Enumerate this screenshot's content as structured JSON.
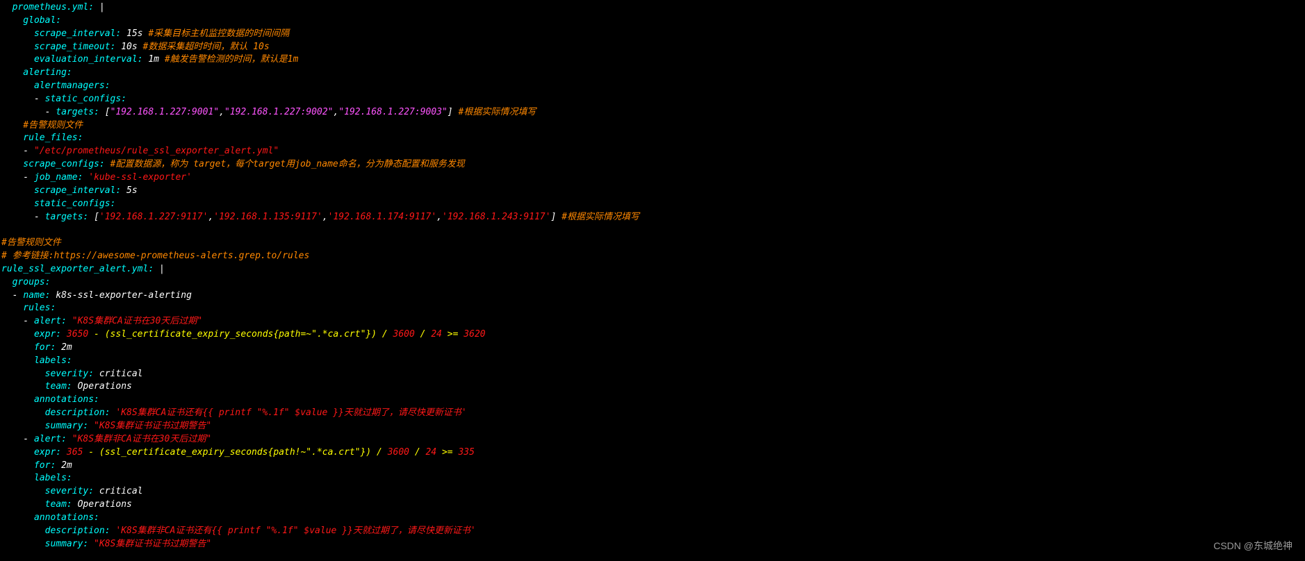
{
  "watermark": "CSDN @东城绝神",
  "blocks": [
    {
      "text": "  prometheus.yml:",
      "cls": "c-cyan"
    },
    {
      "text": " |",
      "cls": "c-white",
      "br": true
    },
    {
      "text": "    global:",
      "cls": "c-cyan",
      "br": true
    },
    {
      "text": "      scrape_interval:",
      "cls": "c-cyan"
    },
    {
      "text": " 15s ",
      "cls": "c-white"
    },
    {
      "text": "#采集目标主机监控数据的时间间隔",
      "cls": "c-orange",
      "br": true
    },
    {
      "text": "      scrape_timeout:",
      "cls": "c-cyan"
    },
    {
      "text": " 10s ",
      "cls": "c-white"
    },
    {
      "text": "#数据采集超时时间，默认 10s",
      "cls": "c-orange",
      "br": true
    },
    {
      "text": "      evaluation_interval:",
      "cls": "c-cyan"
    },
    {
      "text": " 1m ",
      "cls": "c-white"
    },
    {
      "text": "#触发告警检测的时间，默认是1m",
      "cls": "c-orange",
      "br": true
    },
    {
      "text": "    alerting:",
      "cls": "c-cyan",
      "br": true
    },
    {
      "text": "      alertmanagers:",
      "cls": "c-cyan",
      "br": true
    },
    {
      "text": "      - ",
      "cls": "c-white"
    },
    {
      "text": "static_configs:",
      "cls": "c-cyan",
      "br": true
    },
    {
      "text": "        - ",
      "cls": "c-white"
    },
    {
      "text": "targets:",
      "cls": "c-cyan"
    },
    {
      "text": " [",
      "cls": "c-white"
    },
    {
      "text": "\"192.168.1.227:9001\"",
      "cls": "c-magenta"
    },
    {
      "text": ",",
      "cls": "c-white"
    },
    {
      "text": "\"192.168.1.227:9002\"",
      "cls": "c-magenta"
    },
    {
      "text": ",",
      "cls": "c-white"
    },
    {
      "text": "\"192.168.1.227:9003\"",
      "cls": "c-magenta"
    },
    {
      "text": "] ",
      "cls": "c-white"
    },
    {
      "text": "#根据实际情况填写",
      "cls": "c-orange",
      "br": true
    },
    {
      "text": "    #告警规则文件",
      "cls": "c-orange",
      "br": true
    },
    {
      "text": "    rule_files:",
      "cls": "c-cyan",
      "br": true
    },
    {
      "text": "    - ",
      "cls": "c-white"
    },
    {
      "text": "\"/etc/prometheus/rule_ssl_exporter_alert.yml\"",
      "cls": "c-red",
      "br": true
    },
    {
      "text": "    scrape_configs:",
      "cls": "c-cyan"
    },
    {
      "text": " #配置数据源，称为 target，每个target用job_name命名，分为静态配置和服务发现",
      "cls": "c-orange",
      "br": true
    },
    {
      "text": "    - ",
      "cls": "c-white"
    },
    {
      "text": "job_name:",
      "cls": "c-cyan"
    },
    {
      "text": " 'kube-ssl-exporter'",
      "cls": "c-red",
      "br": true
    },
    {
      "text": "      scrape_interval:",
      "cls": "c-cyan"
    },
    {
      "text": " 5s",
      "cls": "c-white",
      "br": true
    },
    {
      "text": "      static_configs:",
      "cls": "c-cyan",
      "br": true
    },
    {
      "text": "      - ",
      "cls": "c-white"
    },
    {
      "text": "targets:",
      "cls": "c-cyan"
    },
    {
      "text": " [",
      "cls": "c-white"
    },
    {
      "text": "'192.168.1.227:9117'",
      "cls": "c-red"
    },
    {
      "text": ",",
      "cls": "c-white"
    },
    {
      "text": "'192.168.1.135:9117'",
      "cls": "c-red"
    },
    {
      "text": ",",
      "cls": "c-white"
    },
    {
      "text": "'192.168.1.174:9117'",
      "cls": "c-red"
    },
    {
      "text": ",",
      "cls": "c-white"
    },
    {
      "text": "'192.168.1.243:9117'",
      "cls": "c-red"
    },
    {
      "text": "] ",
      "cls": "c-white"
    },
    {
      "text": "#根据实际情况填写",
      "cls": "c-orange",
      "br": true
    },
    {
      "text": " ",
      "cls": "c-white",
      "br": true
    },
    {
      "text": "#告警规则文件",
      "cls": "c-orange",
      "br": true
    },
    {
      "text": "# 参考链接:https://awesome-prometheus-alerts.grep.to/rules",
      "cls": "c-orange",
      "br": true
    },
    {
      "text": "rule_ssl_exporter_alert.yml:",
      "cls": "c-cyan"
    },
    {
      "text": " |",
      "cls": "c-white",
      "br": true
    },
    {
      "text": "  groups:",
      "cls": "c-cyan",
      "br": true
    },
    {
      "text": "  - ",
      "cls": "c-white"
    },
    {
      "text": "name:",
      "cls": "c-cyan"
    },
    {
      "text": " k8s-ssl-exporter-alerting",
      "cls": "c-white",
      "br": true
    },
    {
      "text": "    rules:",
      "cls": "c-cyan",
      "br": true
    },
    {
      "text": "    - ",
      "cls": "c-white"
    },
    {
      "text": "alert:",
      "cls": "c-cyan"
    },
    {
      "text": " \"K8S集群CA证书在30天后过期\"",
      "cls": "c-red",
      "br": true
    },
    {
      "text": "      expr:",
      "cls": "c-cyan"
    },
    {
      "text": " 3650",
      "cls": "c-red"
    },
    {
      "text": " - (ssl_certificate_expiry_seconds{path=~\".*ca.crt\"}) / ",
      "cls": "c-yellow"
    },
    {
      "text": "3600",
      "cls": "c-red"
    },
    {
      "text": " / ",
      "cls": "c-yellow"
    },
    {
      "text": "24",
      "cls": "c-red"
    },
    {
      "text": " >= ",
      "cls": "c-yellow"
    },
    {
      "text": "3620",
      "cls": "c-red",
      "br": true
    },
    {
      "text": "      for:",
      "cls": "c-cyan"
    },
    {
      "text": " 2m",
      "cls": "c-white",
      "br": true
    },
    {
      "text": "      labels:",
      "cls": "c-cyan",
      "br": true
    },
    {
      "text": "        severity:",
      "cls": "c-cyan"
    },
    {
      "text": " critical",
      "cls": "c-white",
      "br": true
    },
    {
      "text": "        team:",
      "cls": "c-cyan"
    },
    {
      "text": " Operations",
      "cls": "c-white",
      "br": true
    },
    {
      "text": "      annotations:",
      "cls": "c-cyan",
      "br": true
    },
    {
      "text": "        description:",
      "cls": "c-cyan"
    },
    {
      "text": " 'K8S集群CA证书还有{{ printf \"%.1f\" $value }}天就过期了，请尽快更新证书'",
      "cls": "c-red",
      "br": true
    },
    {
      "text": "        summary:",
      "cls": "c-cyan"
    },
    {
      "text": " \"K8S集群证书证书过期警告\"",
      "cls": "c-red",
      "br": true
    },
    {
      "text": "    - ",
      "cls": "c-white"
    },
    {
      "text": "alert:",
      "cls": "c-cyan"
    },
    {
      "text": " \"K8S集群非CA证书在30天后过期\"",
      "cls": "c-red",
      "br": true
    },
    {
      "text": "      expr:",
      "cls": "c-cyan"
    },
    {
      "text": " 365",
      "cls": "c-red"
    },
    {
      "text": " - (ssl_certificate_expiry_seconds{path!~\".*ca.crt\"}) / ",
      "cls": "c-yellow"
    },
    {
      "text": "3600",
      "cls": "c-red"
    },
    {
      "text": " / ",
      "cls": "c-yellow"
    },
    {
      "text": "24",
      "cls": "c-red"
    },
    {
      "text": " >= ",
      "cls": "c-yellow"
    },
    {
      "text": "335",
      "cls": "c-red",
      "br": true
    },
    {
      "text": "      for:",
      "cls": "c-cyan"
    },
    {
      "text": " 2m",
      "cls": "c-white",
      "br": true
    },
    {
      "text": "      labels:",
      "cls": "c-cyan",
      "br": true
    },
    {
      "text": "        severity:",
      "cls": "c-cyan"
    },
    {
      "text": " critical",
      "cls": "c-white",
      "br": true
    },
    {
      "text": "        team:",
      "cls": "c-cyan"
    },
    {
      "text": " Operations",
      "cls": "c-white",
      "br": true
    },
    {
      "text": "      annotations:",
      "cls": "c-cyan",
      "br": true
    },
    {
      "text": "        description:",
      "cls": "c-cyan"
    },
    {
      "text": " 'K8S集群非CA证书还有{{ printf \"%.1f\" $value }}天就过期了，请尽快更新证书'",
      "cls": "c-red",
      "br": true
    },
    {
      "text": "        summary:",
      "cls": "c-cyan"
    },
    {
      "text": " \"K8S集群证书证书过期警告\"",
      "cls": "c-red",
      "br": true
    }
  ]
}
